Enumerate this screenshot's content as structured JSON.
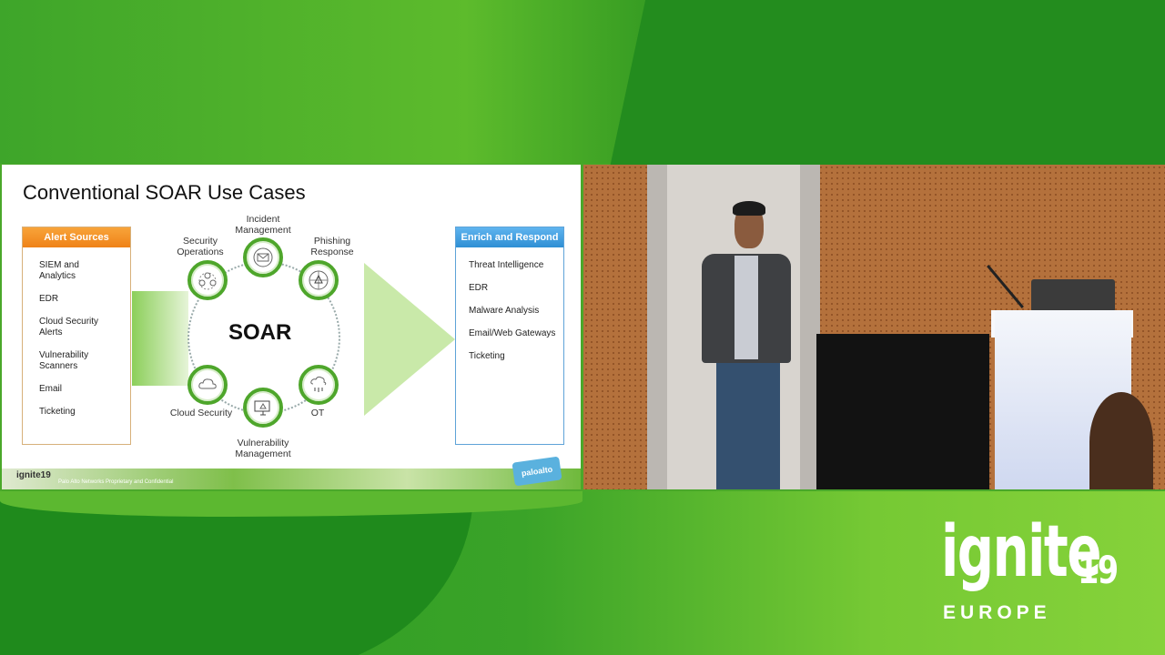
{
  "slide": {
    "title": "Conventional SOAR Use Cases",
    "alert_sources": {
      "header": "Alert Sources",
      "items": [
        "SIEM and Analytics",
        "EDR",
        "Cloud Security Alerts",
        "Vulnerability Scanners",
        "Email",
        "Ticketing"
      ]
    },
    "enrich_respond": {
      "header": "Enrich and Respond",
      "items": [
        "Threat Intelligence",
        "EDR",
        "Malware Analysis",
        "Email/Web Gateways",
        "Ticketing"
      ]
    },
    "center_label": "SOAR",
    "nodes": {
      "incident": "Incident Management",
      "security_ops": "Security Operations",
      "phishing": "Phishing Response",
      "cloud": "Cloud Security",
      "vuln": "Vulnerability Management",
      "ot": "OT"
    },
    "footer_text": "Palo Alto Networks Proprietary and Confidential",
    "footer_logo": "ignite19",
    "vendor_badge": "paloalto"
  },
  "event": {
    "word": "ignite",
    "year": "19",
    "region": "EUROPE"
  },
  "icons": [
    "people-icon",
    "envelope-icon",
    "cloud-icon",
    "monitor-icon",
    "server-icon",
    "hub-icon"
  ],
  "colors": {
    "accent_green": "#4ea62b",
    "alert_orange": "#ef8218",
    "respond_blue": "#2f8fd4"
  }
}
